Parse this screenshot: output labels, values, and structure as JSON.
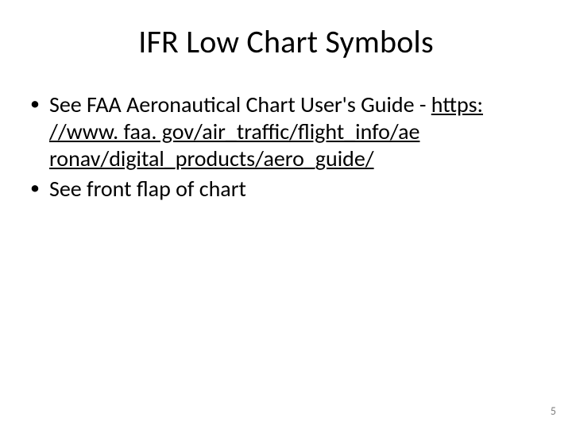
{
  "title": "IFR Low Chart Symbols",
  "bullets": {
    "b1_lead": "See FAA Aeronautical Chart User's Guide - ",
    "b1_link": "https: //www. faa. gov/air_traffic/flight_info/ae ronav/digital_products/aero_guide/",
    "b2": "See front flap of chart"
  },
  "page_number": "5"
}
